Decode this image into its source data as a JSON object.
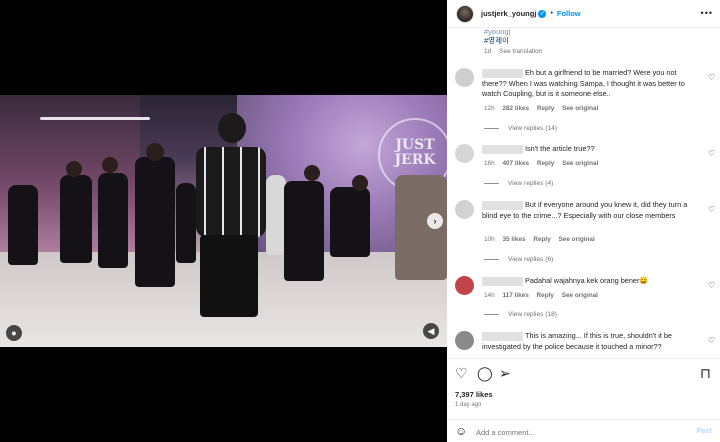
{
  "header": {
    "username": "justjerk_youngj",
    "separator": "•",
    "follow_label": "Follow",
    "more_icon": "more-horizontal-icon"
  },
  "media": {
    "seal_text": "JUST JERK",
    "next_icon": "chevron-right-icon",
    "tag_icon": "user-tag-icon",
    "mute_icon": "volume-muted-icon"
  },
  "caption": {
    "tag_partial": "#youngj",
    "tag_korean": "#영제이",
    "time": "1d",
    "see_translation": "See translation"
  },
  "comments": [
    {
      "text": "Eh but a girlfriend to be married? Were you not there?? When I was watching Sampa, I thought it was better to watch Coupling, but is it someone else..",
      "time": "12h",
      "likes": "282 likes",
      "reply": "Reply",
      "see_original": "See original",
      "view_replies": "View replies (14)",
      "avatar_color": "#cfcfcf"
    },
    {
      "text": "Isn't the article true??",
      "time": "16h",
      "likes": "407 likes",
      "reply": "Reply",
      "see_original": "See original",
      "view_replies": "View replies (4)",
      "avatar_color": "#d6d6d6"
    },
    {
      "text": "But if everyone around you knew it, did they turn a blind eye to the crime...? Especially with our close members",
      "time": "10h",
      "likes": "35 likes",
      "reply": "Reply",
      "see_original": "See original",
      "view_replies": "View replies (6)",
      "avatar_color": "#d2d2d2"
    },
    {
      "text": "Padahal wajahnya kek orang bener😄",
      "time": "14h",
      "likes": "117 likes",
      "reply": "Reply",
      "see_original": "See original",
      "view_replies": "View replies (18)",
      "avatar_color": "#c0444a"
    },
    {
      "text": "This is amazing... If this is true, shouldn't it be investigated by the police because it touched a minor??",
      "time": "",
      "likes": "",
      "reply": "",
      "see_original": "",
      "view_replies": "",
      "avatar_color": "#8a8a8a"
    }
  ],
  "actions": {
    "likes": "7,397 likes",
    "date": "1 day ago"
  },
  "add_comment": {
    "placeholder": "Add a comment...",
    "post_label": "Post"
  },
  "colors": {
    "accent": "#0095f6",
    "muted": "#737373"
  }
}
